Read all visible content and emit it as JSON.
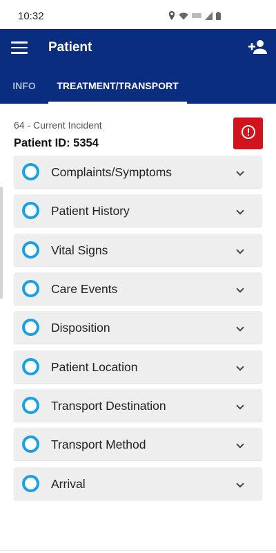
{
  "status_bar": {
    "time": "10:32",
    "icons": [
      "location-icon",
      "wifi-icon",
      "lte-icon",
      "signal-icon",
      "battery-icon"
    ]
  },
  "app_bar": {
    "title": "Patient",
    "menu_icon": "hamburger-menu-icon",
    "action_icon": "add-person-icon",
    "background": "#0a2d80"
  },
  "tabs": [
    {
      "label": "INFO",
      "active": false
    },
    {
      "label": "TREATMENT/TRANSPORT",
      "active": true
    }
  ],
  "header": {
    "incident": "64 - Current Incident",
    "patient_id": "Patient ID: 5354",
    "alert_icon": "alert-circle-icon",
    "alert_color": "#d0131d"
  },
  "sections": [
    {
      "label": "Complaints/Symptoms"
    },
    {
      "label": "Patient History"
    },
    {
      "label": "Vital Signs"
    },
    {
      "label": "Care Events"
    },
    {
      "label": "Disposition"
    },
    {
      "label": "Patient Location"
    },
    {
      "label": "Transport Destination"
    },
    {
      "label": "Transport Method"
    },
    {
      "label": "Arrival"
    }
  ],
  "colors": {
    "status_ring": "#1ba0e0",
    "section_bg": "#eeeeee"
  }
}
